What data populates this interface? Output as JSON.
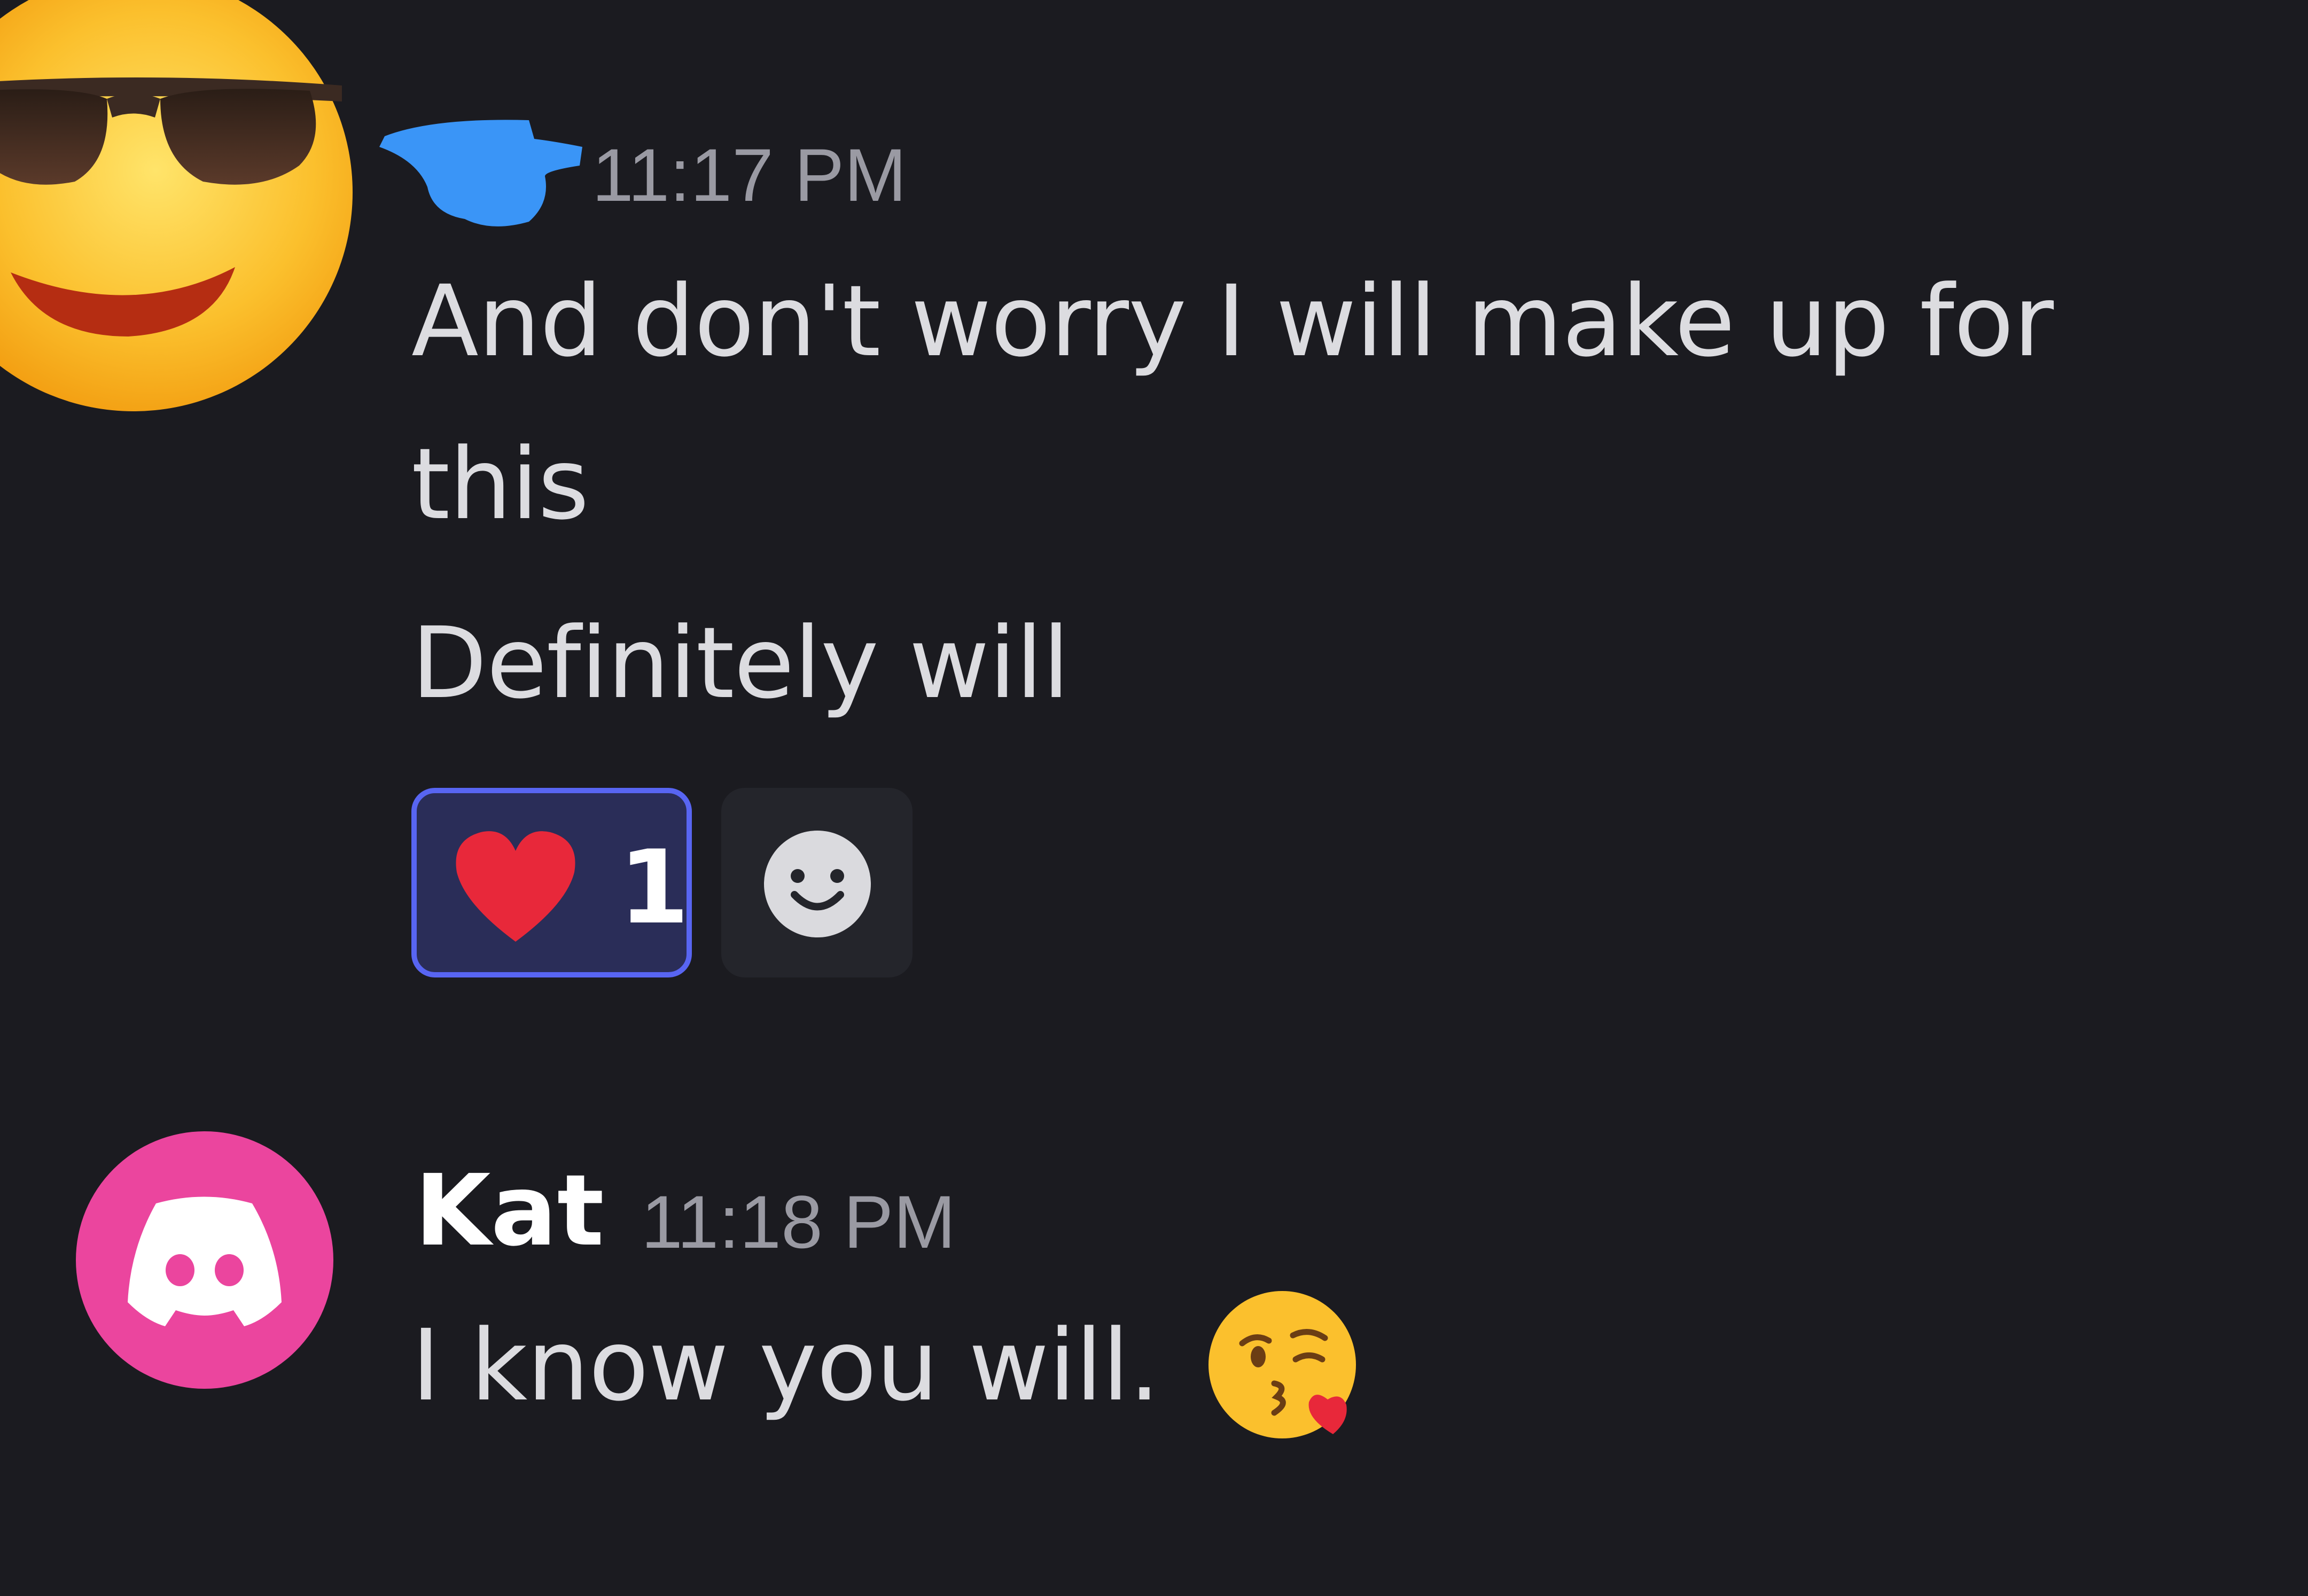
{
  "message_group_1": {
    "author_name": "",
    "timestamp": "11:17 PM",
    "lines": [
      "And don't worry I will make up for",
      "this",
      "Definitely will"
    ],
    "reactions": [
      {
        "emoji": "heart-icon",
        "count": "1",
        "selected": true
      },
      {
        "emoji": "add-reaction-icon",
        "count": ""
      }
    ],
    "avatar_icon": "sunglasses-emoji-avatar"
  },
  "message_group_2": {
    "author_name": "Kat",
    "timestamp": "11:18 PM",
    "text": "I know you will.",
    "trailing_emoji": "kissing-face-heart-emoji",
    "avatar_icon": "discord-logo-icon",
    "avatar_color": "#eb459e"
  },
  "colors": {
    "background": "#1b1b20",
    "text": "#dcdce0",
    "timestamp": "#9a9aa3",
    "reaction_selected_bg": "#2a2d58",
    "reaction_selected_border": "#5865f2",
    "redaction_blue": "#3a95f7"
  }
}
